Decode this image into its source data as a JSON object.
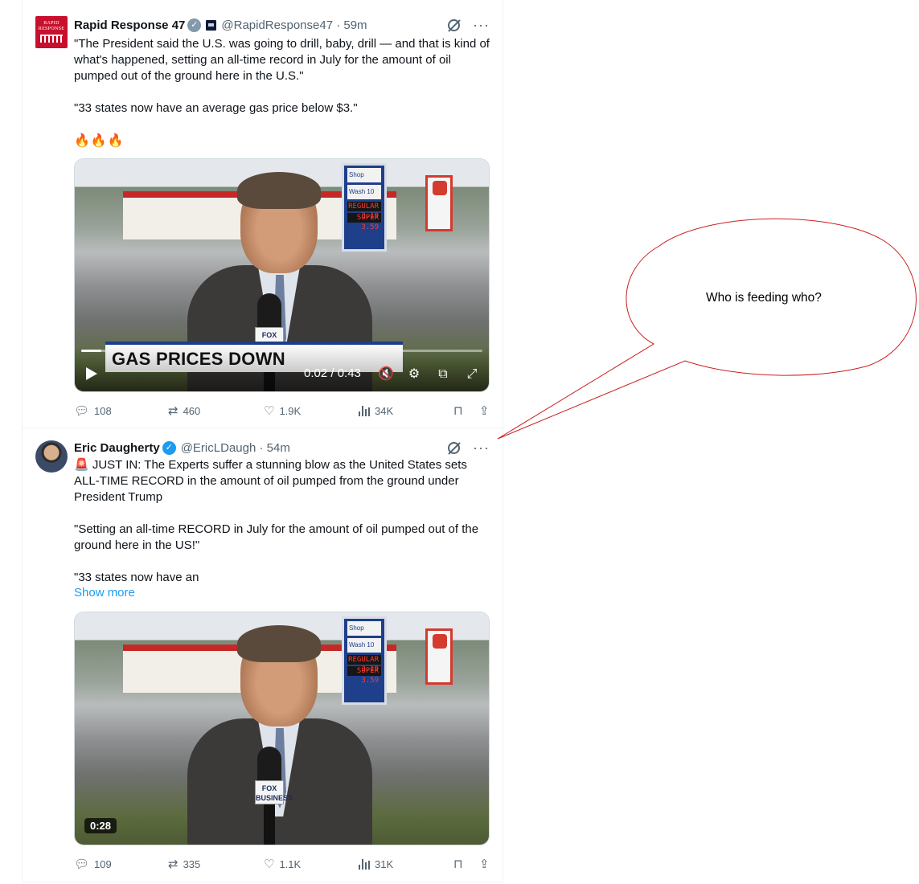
{
  "tweets": [
    {
      "display_name": "Rapid Response 47",
      "avatar_text": "RAPID RESPONSE",
      "handle_time": "@RapidResponse47 · 59m",
      "text": "\"The President said the U.S. was going to drill, baby, drill — and that is kind of what's happened, setting an all-time record in July for the amount of oil pumped out of the ground here in the U.S.\"\n\n\"33 states now have an average gas price below $3.\"",
      "emoji": "🔥🔥🔥",
      "video": {
        "lower_third": "GAS PRICES DOWN",
        "time": "0:02 / 0:43",
        "progress": 0.05,
        "sign_labels": [
          "Shop",
          "Wash 10",
          "REGULAR 3.19",
          "SUPER 3.59"
        ],
        "mic_flag": "FOX"
      },
      "stats": {
        "replies": "108",
        "reposts": "460",
        "likes": "1.9K",
        "views": "34K"
      }
    },
    {
      "display_name": "Eric Daugherty",
      "handle_time": "@EricLDaugh · 54m",
      "text": "🚨 JUST IN: The Experts suffer a stunning blow as the United States sets ALL-TIME RECORD in the amount of oil pumped from the ground under President Trump\n\n\"Setting an all-time RECORD in July for the amount of oil pumped out of the ground here in the US!\"\n\n\"33 states now have an",
      "show_more": "Show more",
      "video": {
        "duration": "0:28",
        "sign_labels": [
          "Shop",
          "Wash 10",
          "REGULAR 3.19",
          "SUPER 3.59"
        ],
        "mic_flag": "FOX BUSINESS"
      },
      "stats": {
        "replies": "109",
        "reposts": "335",
        "likes": "1.1K",
        "views": "31K"
      }
    }
  ],
  "annotation": {
    "bubble_text": "Who is feeding who?",
    "outline_color": "#cc1f1f"
  },
  "icons": {
    "verified_grey": "verified-badge-grey",
    "verified_blue": "verified-badge-blue",
    "grok": "grok-icon",
    "more": "more-icon",
    "reply": "reply-icon",
    "repost": "repost-icon",
    "like": "like-icon",
    "views": "views-icon",
    "bookmark": "bookmark-icon",
    "share": "share-icon"
  },
  "colors": {
    "link_blue": "#1d9bf0",
    "secondary_text": "#536471",
    "verified_blue": "#1d9bf0",
    "verified_grey": "#829aab"
  }
}
